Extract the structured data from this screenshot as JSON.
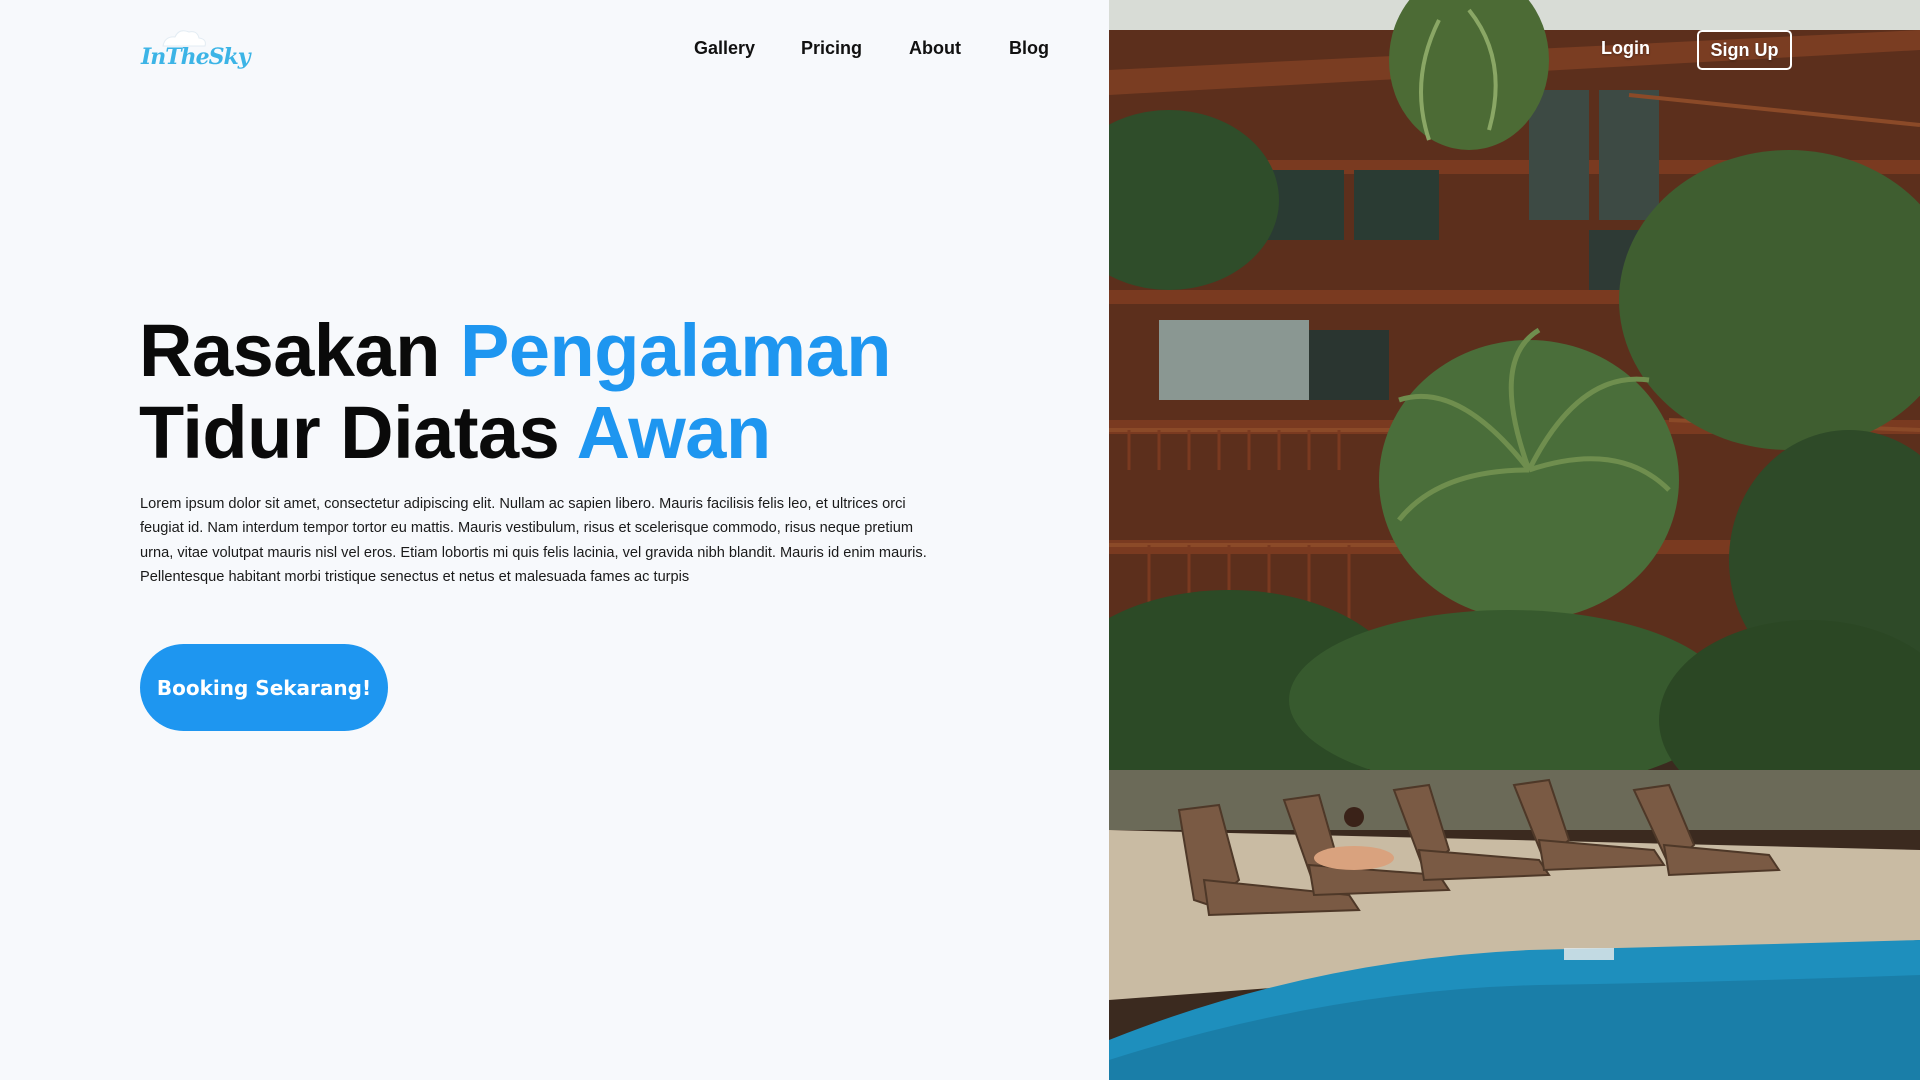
{
  "brand": {
    "logo_text": "InTheSky",
    "accent_color": "#1e96f0",
    "logo_color": "#3cb4e6"
  },
  "nav": {
    "items": [
      {
        "label": "Gallery"
      },
      {
        "label": "Pricing"
      },
      {
        "label": "About"
      },
      {
        "label": "Blog"
      }
    ],
    "login_label": "Login",
    "signup_label": "Sign Up"
  },
  "hero": {
    "headline_line1_plain": "Rasakan",
    "headline_line1_accent": "Pengalaman",
    "headline_line2_plain": "Tidur Diatas",
    "headline_line2_accent": "Awan",
    "description": "Lorem ipsum dolor sit amet, consectetur adipiscing elit. Nullam ac sapien libero. Mauris facilisis felis leo, et ultrices orci feugiat id. Nam interdum tempor tortor eu mattis. Mauris vestibulum, risus et scelerisque commodo, risus neque pretium urna, vitae volutpat mauris nisl vel eros. Etiam lobortis mi quis felis lacinia, vel gravida nibh blandit. Mauris id enim mauris. Pellentesque habitant morbi tristique senectus et netus et malesuada fames ac turpis",
    "cta_label": "Booking Sekarang!"
  }
}
